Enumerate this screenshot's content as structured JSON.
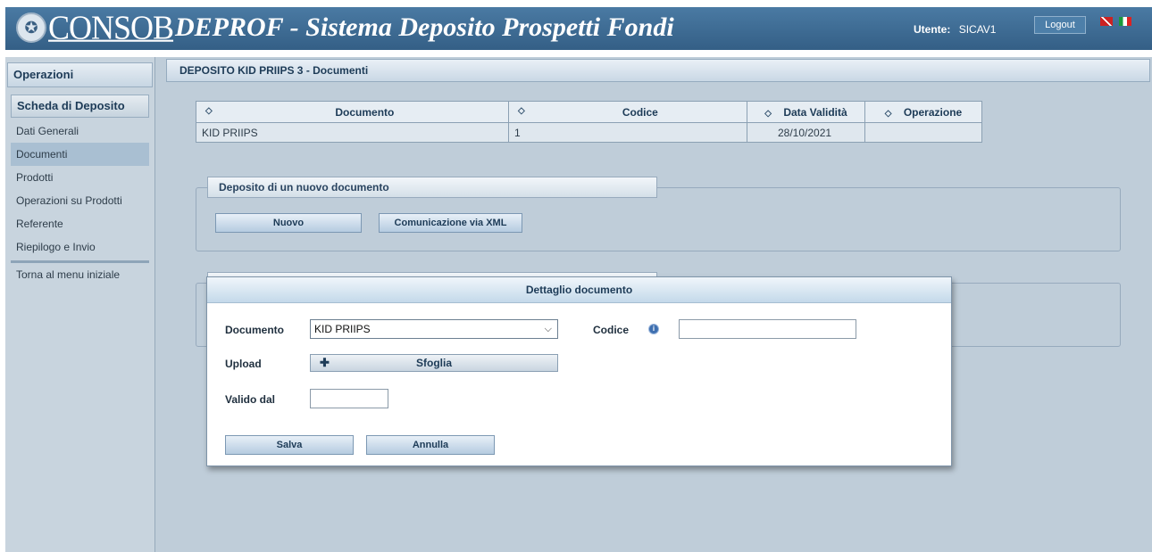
{
  "header": {
    "logo_text": "CONSOB",
    "app_title": "DEPROF - Sistema Deposito Prospetti Fondi",
    "user_label": "Utente:",
    "user_name": "SICAV1",
    "logout_label": "Logout"
  },
  "sidebar": {
    "title": "Operazioni",
    "section": "Scheda di Deposito",
    "items": [
      {
        "label": "Dati Generali"
      },
      {
        "label": "Documenti"
      },
      {
        "label": "Prodotti"
      },
      {
        "label": "Operazioni su Prodotti"
      },
      {
        "label": "Referente"
      },
      {
        "label": "Riepilogo e Invio"
      }
    ],
    "back_label": "Torna al menu iniziale"
  },
  "content": {
    "title": "DEPOSITO KID PRIIPS 3 - Documenti",
    "table": {
      "headers": [
        "Documento",
        "Codice",
        "Data Validità",
        "Operazione"
      ],
      "rows": [
        [
          "KID PRIIPS",
          "1",
          "28/10/2021",
          ""
        ]
      ]
    },
    "new_doc": {
      "legend": "Deposito di un nuovo documento",
      "new_button": "Nuovo",
      "xml_button": "Comunicazione via XML"
    }
  },
  "modal": {
    "title": "Dettaglio documento",
    "documento_label": "Documento",
    "documento_value": "KID PRIIPS",
    "codice_label": "Codice",
    "codice_value": "",
    "upload_label": "Upload",
    "upload_button": "Sfoglia",
    "valido_label": "Valido dal",
    "valido_value": "",
    "save_button": "Salva",
    "cancel_button": "Annulla"
  }
}
